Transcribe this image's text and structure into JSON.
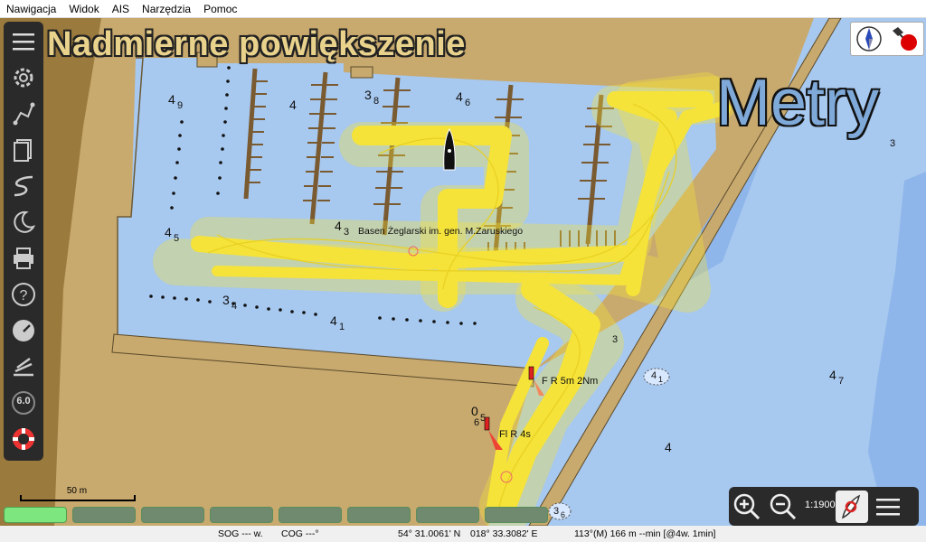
{
  "menu": {
    "items": [
      "Nawigacja",
      "Widok",
      "AIS",
      "Narzędzia",
      "Pomoc"
    ]
  },
  "overlay": {
    "overzoom_warning": "Nadmierne powiększenie",
    "units": "Metry"
  },
  "chart": {
    "harbour_name": "Basen Żeglarski im. gen. M.Zaruskiego",
    "lights": [
      "F R 5m 2Nm",
      "Fl R 4s"
    ],
    "soundings": [
      {
        "main": "4",
        "sub": "9"
      },
      {
        "main": "4",
        "sub": ""
      },
      {
        "main": "3",
        "sub": "8"
      },
      {
        "main": "4",
        "sub": "6"
      },
      {
        "main": "4",
        "sub": "5"
      },
      {
        "main": "4",
        "sub": "3"
      },
      {
        "main": "3",
        "sub": "4"
      },
      {
        "main": "4",
        "sub": "1"
      },
      {
        "main": "",
        "sub": "3"
      },
      {
        "main": "4",
        "sub": "1"
      },
      {
        "main": "4",
        "sub": "7"
      },
      {
        "main": "0",
        "sub": "5"
      },
      {
        "main": "6",
        "sub": ""
      },
      {
        "main": "4",
        "sub": ""
      },
      {
        "main": "3",
        "sub": "6"
      },
      {
        "main": "",
        "sub": "3"
      }
    ]
  },
  "scale_bar": {
    "label": "50 m"
  },
  "zoom": {
    "scale": "1:1900"
  },
  "status": {
    "sog": "SOG --- w.",
    "cog": "COG ---°",
    "lat": "54° 31.0061' N",
    "lon": "018° 33.3082' E",
    "cursor": "113°(M)  166 m --min [@4w. 1min]"
  },
  "colors": {
    "water": "#a7c8ef",
    "land": "#c8a96e",
    "shallow": "#8fb6ea",
    "track": "#f5e33a",
    "toolbar": "#2a2a2a",
    "accent_green": "#7ee67e"
  },
  "toolbar": {
    "icons": [
      "menu-icon",
      "settings-icon",
      "route-icon",
      "layers-icon",
      "track-icon",
      "moon-icon",
      "print-icon",
      "help-icon",
      "dashboard-icon",
      "ais-icon",
      "speed-icon",
      "lifebuoy-icon"
    ],
    "speed_label": "6.0"
  }
}
